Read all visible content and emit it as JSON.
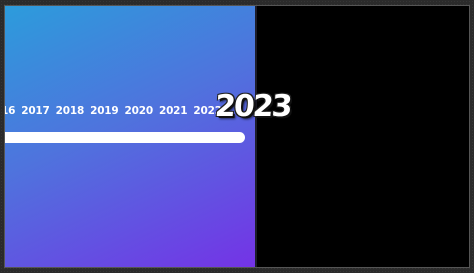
{
  "timeline": {
    "years": [
      "16",
      "2017",
      "2018",
      "2019",
      "2020",
      "2021",
      "2022"
    ],
    "current_year": "2023",
    "progress_fraction": 1.0
  },
  "colors": {
    "gradient_start": "#2c9cdc",
    "gradient_end": "#7433e6",
    "right_panel": "#000000",
    "text": "#ffffff"
  }
}
